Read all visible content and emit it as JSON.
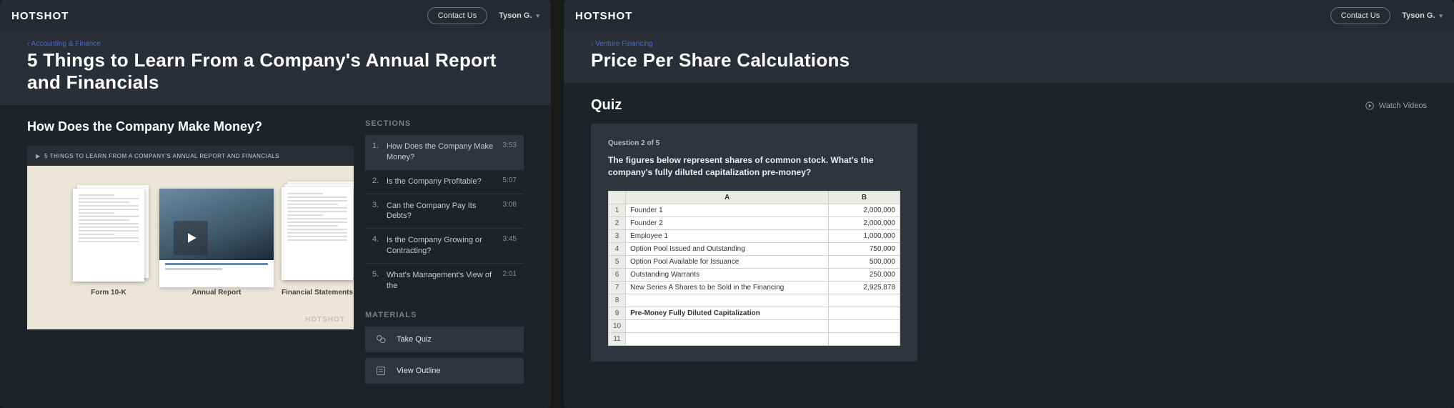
{
  "topbar": {
    "logo": "HOTSHOT",
    "contact_label": "Contact Us",
    "user_name": "Tyson G."
  },
  "left": {
    "crumb": "‹ Accounting & Finance",
    "title": "5 Things to Learn From a Company's Annual Report and Financials",
    "section_heading": "How Does the Company Make Money?",
    "video_overline": "5 THINGS TO LEARN FROM A COMPANY'S ANNUAL REPORT AND FINANCIALS",
    "doc_caption_1": "Form 10-K",
    "doc_caption_2": "Annual Report",
    "doc_caption_3": "Financial Statements",
    "thumb_footer": "HOTSHOT",
    "sections_label": "SECTIONS",
    "sections": [
      {
        "num": "1.",
        "title": "How Does the Company Make Money?",
        "dur": "3:53",
        "active": true
      },
      {
        "num": "2.",
        "title": "Is the Company Profitable?",
        "dur": "5:07"
      },
      {
        "num": "3.",
        "title": "Can the Company Pay Its Debts?",
        "dur": "3:08"
      },
      {
        "num": "4.",
        "title": "Is the Company Growing or Contracting?",
        "dur": "3:45"
      },
      {
        "num": "5.",
        "title": "What's Management's View of the",
        "dur": "2:01"
      }
    ],
    "materials_label": "MATERIALS",
    "materials": {
      "take_quiz": "Take Quiz",
      "view_outline": "View Outline"
    }
  },
  "right": {
    "crumb": "‹ Venture Financing",
    "title": "Price Per Share Calculations",
    "quiz_heading": "Quiz",
    "watch_label": "Watch Videos",
    "q_progress": "Question 2 of 5",
    "q_text": "The figures below represent shares of common stock. What's the company's fully diluted capitalization pre-money?",
    "sheet": {
      "headers": [
        "",
        "A",
        "B"
      ],
      "rows": [
        {
          "n": "1",
          "a": "Founder 1",
          "b": "2,000,000"
        },
        {
          "n": "2",
          "a": "Founder 2",
          "b": "2,000,000"
        },
        {
          "n": "3",
          "a": "Employee 1",
          "b": "1,000,000"
        },
        {
          "n": "4",
          "a": "Option Pool Issued and Outstanding",
          "b": "750,000"
        },
        {
          "n": "5",
          "a": "Option Pool Available for Issuance",
          "b": "500,000"
        },
        {
          "n": "6",
          "a": "Outstanding Warrants",
          "b": "250,000"
        },
        {
          "n": "7",
          "a": "New Series A Shares to be Sold in the Financing",
          "b": "2,925,878"
        },
        {
          "n": "8",
          "a": "",
          "b": ""
        },
        {
          "n": "9",
          "a": "Pre-Money Fully Diluted Capitalization",
          "b": "",
          "bold": true
        },
        {
          "n": "10",
          "a": "",
          "b": ""
        },
        {
          "n": "11",
          "a": "",
          "b": ""
        }
      ]
    }
  }
}
